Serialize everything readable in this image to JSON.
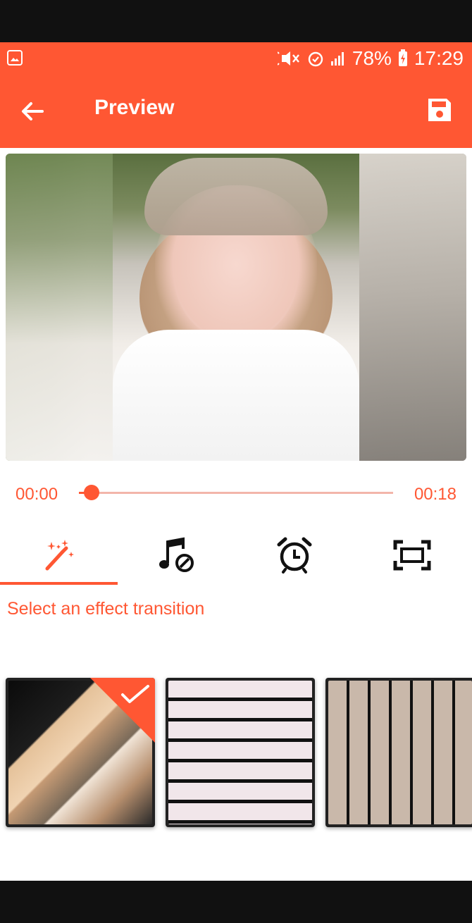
{
  "status": {
    "battery": "78%",
    "time": "17:29"
  },
  "appbar": {
    "title": "Preview"
  },
  "player": {
    "current_time": "00:00",
    "total_time": "00:18",
    "progress": 0.04
  },
  "tabs": [
    {
      "name": "effects",
      "active": true
    },
    {
      "name": "music",
      "active": false
    },
    {
      "name": "duration",
      "active": false
    },
    {
      "name": "crop",
      "active": false
    }
  ],
  "section": {
    "label": "Select an effect transition"
  },
  "transitions": [
    {
      "selected": true
    },
    {
      "selected": false
    },
    {
      "selected": false
    }
  ],
  "colors": {
    "accent": "#FF5733",
    "accent_light": "#F3B6AA"
  }
}
